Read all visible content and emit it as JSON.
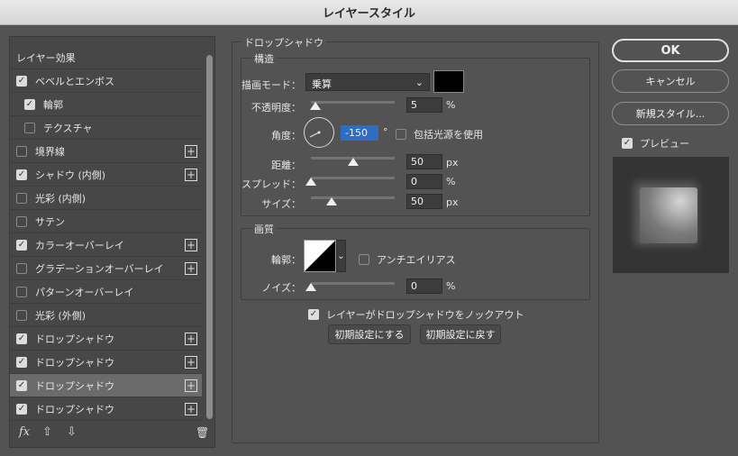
{
  "window": {
    "title": "レイヤースタイル"
  },
  "sidebar": {
    "header": "レイヤー効果",
    "items": [
      {
        "label": "ベベルとエンボス",
        "checked": true,
        "plus": false,
        "sub": false
      },
      {
        "label": "輪郭",
        "checked": true,
        "plus": false,
        "sub": true
      },
      {
        "label": "テクスチャ",
        "checked": false,
        "plus": false,
        "sub": true
      },
      {
        "label": "境界線",
        "checked": false,
        "plus": true,
        "sub": false
      },
      {
        "label": "シャドウ (内側)",
        "checked": true,
        "plus": true,
        "sub": false
      },
      {
        "label": "光彩 (内側)",
        "checked": false,
        "plus": false,
        "sub": false
      },
      {
        "label": "サテン",
        "checked": false,
        "plus": false,
        "sub": false
      },
      {
        "label": "カラーオーバーレイ",
        "checked": true,
        "plus": true,
        "sub": false
      },
      {
        "label": "グラデーションオーバーレイ",
        "checked": false,
        "plus": true,
        "sub": false
      },
      {
        "label": "パターンオーバーレイ",
        "checked": false,
        "plus": false,
        "sub": false
      },
      {
        "label": "光彩 (外側)",
        "checked": false,
        "plus": false,
        "sub": false
      },
      {
        "label": "ドロップシャドウ",
        "checked": true,
        "plus": true,
        "sub": false
      },
      {
        "label": "ドロップシャドウ",
        "checked": true,
        "plus": true,
        "sub": false
      },
      {
        "label": "ドロップシャドウ",
        "checked": true,
        "plus": true,
        "sub": false,
        "selected": true
      },
      {
        "label": "ドロップシャドウ",
        "checked": true,
        "plus": true,
        "sub": false
      }
    ],
    "tools": {
      "fx": "fx",
      "up": "⇧",
      "down": "⇩",
      "trash": "🗑"
    }
  },
  "panel": {
    "title": "ドロップシャドウ",
    "structure": {
      "title": "構造",
      "blend_mode_label": "描画モード：",
      "blend_mode_value": "乗算",
      "swatch_color": "#000000",
      "opacity_label": "不透明度：",
      "opacity_value": "5",
      "opacity_fraction": 0.05,
      "percent": "%",
      "angle_label": "角度：",
      "angle_value": "-150",
      "degree": "°",
      "global_light_label": "包括光源を使用",
      "global_light_checked": false,
      "distance_label": "距離：",
      "distance_value": "50",
      "distance_fraction": 0.5,
      "px": "px",
      "spread_label": "スプレッド：",
      "spread_value": "0",
      "spread_fraction": 0.0,
      "size_label": "サイズ：",
      "size_value": "50",
      "size_fraction": 0.25
    },
    "quality": {
      "title": "画質",
      "contour_label": "輪郭：",
      "antialias_label": "アンチエイリアス",
      "antialias_checked": false,
      "noise_label": "ノイズ：",
      "noise_value": "0",
      "noise_fraction": 0.0
    },
    "knockout_label": "レイヤーがドロップシャドウをノックアウト",
    "knockout_checked": true,
    "make_default_label": "初期設定にする",
    "reset_default_label": "初期設定に戻す"
  },
  "actions": {
    "ok": "OK",
    "cancel": "キャンセル",
    "new_style": "新規スタイル...",
    "preview_label": "プレビュー",
    "preview_checked": true
  }
}
